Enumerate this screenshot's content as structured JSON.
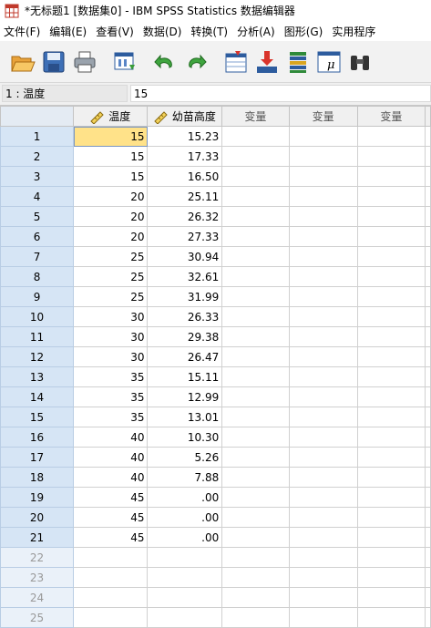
{
  "window": {
    "title": "*无标题1 [数据集0] - IBM SPSS Statistics 数据编辑器"
  },
  "menu": [
    "文件(F)",
    "编辑(E)",
    "查看(V)",
    "数据(D)",
    "转换(T)",
    "分析(A)",
    "图形(G)",
    "实用程序"
  ],
  "toolbar": {
    "buttons": [
      "open-icon",
      "save-icon",
      "print-icon",
      "recall-dialog-icon",
      "undo-icon",
      "redo-icon",
      "goto-case-icon",
      "goto-variable-icon",
      "variables-icon",
      "value-labels-icon",
      "binoculars-icon"
    ]
  },
  "cellbar": {
    "ref": "1 : 温度",
    "value": "15"
  },
  "columns": [
    "温度",
    "幼苗高度",
    "变量",
    "变量",
    "变量"
  ],
  "rows": [
    {
      "n": "1",
      "a": "15",
      "b": "15.23"
    },
    {
      "n": "2",
      "a": "15",
      "b": "17.33"
    },
    {
      "n": "3",
      "a": "15",
      "b": "16.50"
    },
    {
      "n": "4",
      "a": "20",
      "b": "25.11"
    },
    {
      "n": "5",
      "a": "20",
      "b": "26.32"
    },
    {
      "n": "6",
      "a": "20",
      "b": "27.33"
    },
    {
      "n": "7",
      "a": "25",
      "b": "30.94"
    },
    {
      "n": "8",
      "a": "25",
      "b": "32.61"
    },
    {
      "n": "9",
      "a": "25",
      "b": "31.99"
    },
    {
      "n": "10",
      "a": "30",
      "b": "26.33"
    },
    {
      "n": "11",
      "a": "30",
      "b": "29.38"
    },
    {
      "n": "12",
      "a": "30",
      "b": "26.47"
    },
    {
      "n": "13",
      "a": "35",
      "b": "15.11"
    },
    {
      "n": "14",
      "a": "35",
      "b": "12.99"
    },
    {
      "n": "15",
      "a": "35",
      "b": "13.01"
    },
    {
      "n": "16",
      "a": "40",
      "b": "10.30"
    },
    {
      "n": "17",
      "a": "40",
      "b": "5.26"
    },
    {
      "n": "18",
      "a": "40",
      "b": "7.88"
    },
    {
      "n": "19",
      "a": "45",
      "b": ".00"
    },
    {
      "n": "20",
      "a": "45",
      "b": ".00"
    },
    {
      "n": "21",
      "a": "45",
      "b": ".00"
    }
  ],
  "empty_rows": [
    "22",
    "23",
    "24",
    "25"
  ],
  "colors": {
    "row_header": "#d6e5f5",
    "selected_cell": "#ffe289",
    "header_bg": "#f0f0f0"
  }
}
